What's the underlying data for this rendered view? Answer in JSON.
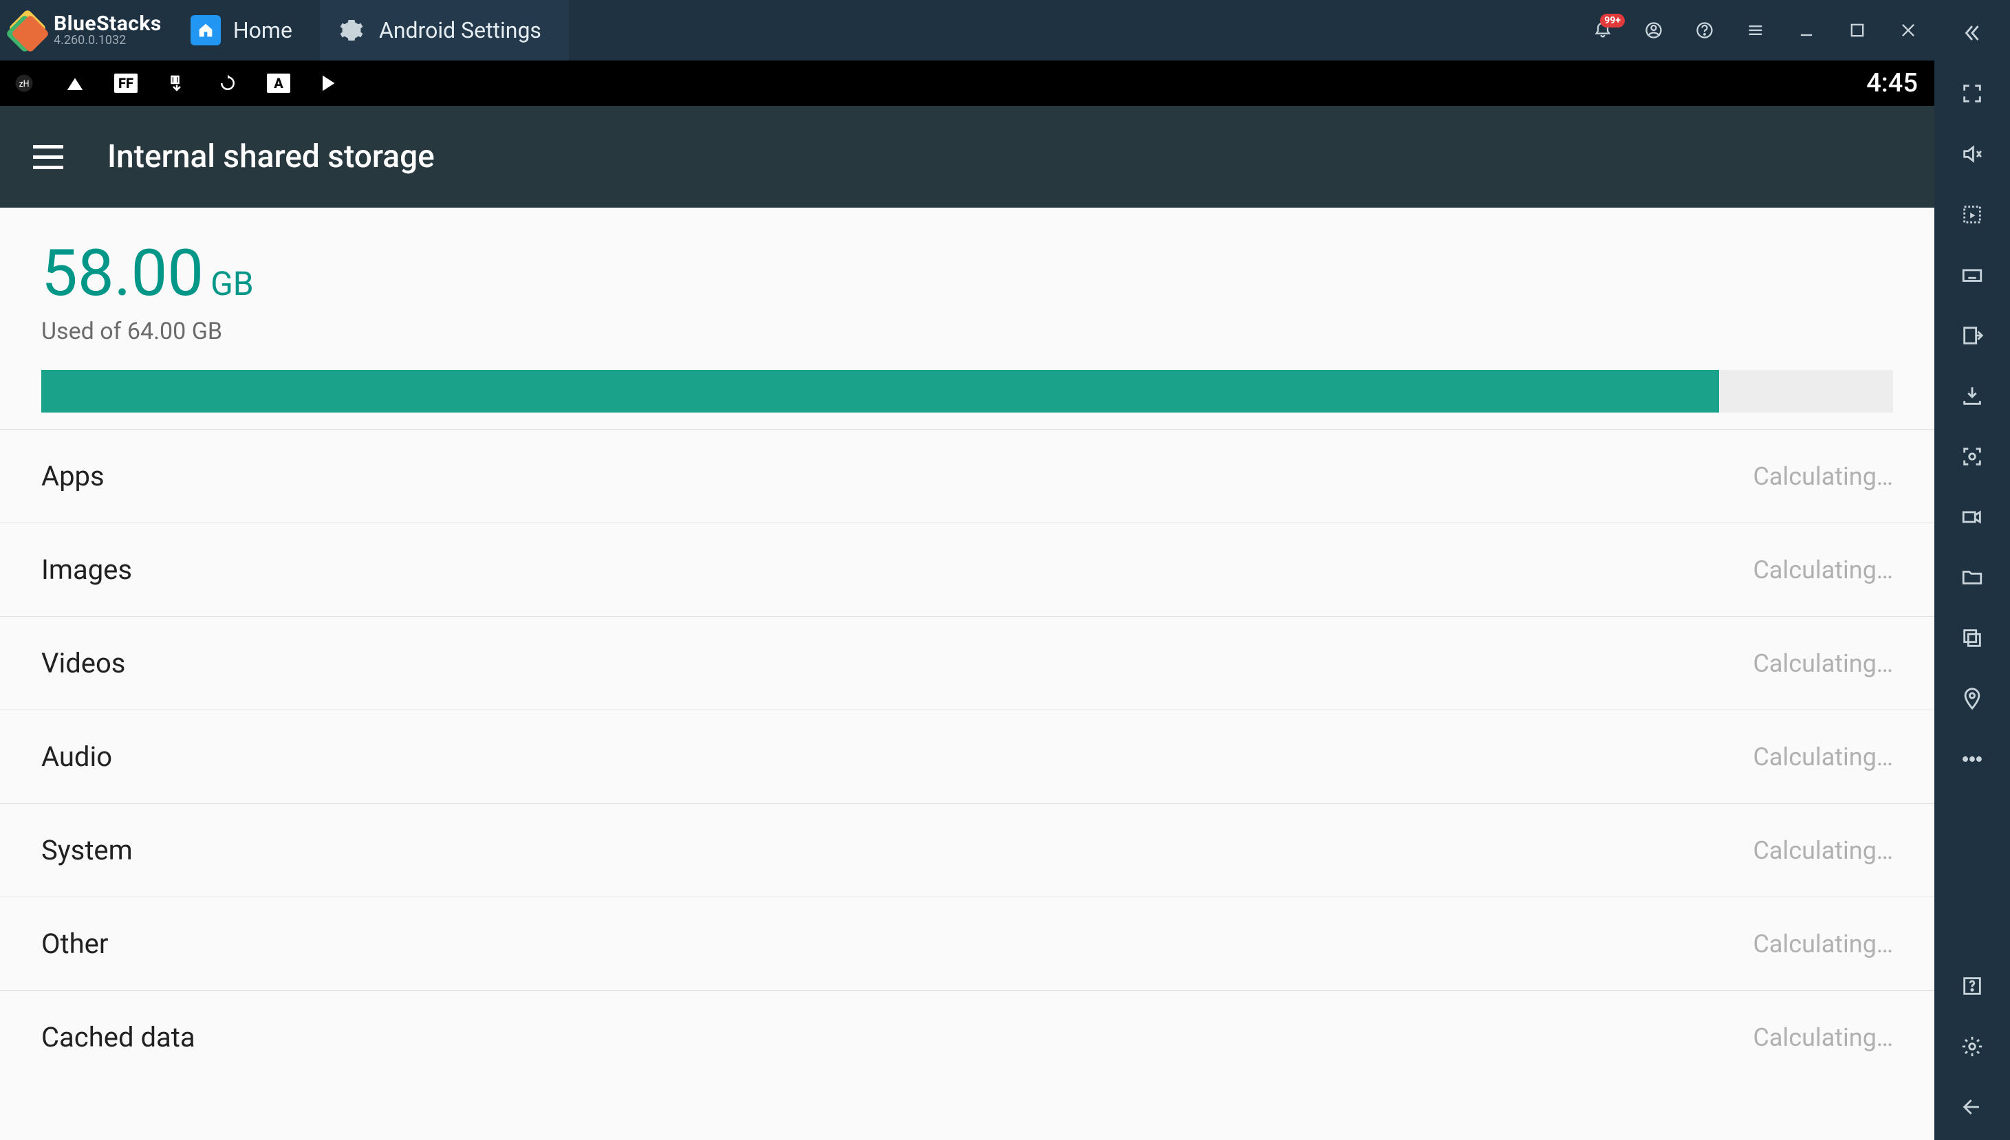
{
  "app": {
    "name": "BlueStacks",
    "version": "4.260.0.1032"
  },
  "tabs": [
    {
      "label": "Home",
      "active": false
    },
    {
      "label": "Android Settings",
      "active": true
    }
  ],
  "window_controls": {
    "notification_badge": "99+"
  },
  "status_bar": {
    "clock": "4:45"
  },
  "appbar": {
    "title": "Internal shared storage"
  },
  "storage": {
    "used_value": "58.00",
    "used_unit": "GB",
    "total_line": "Used of 64.00 GB",
    "fill_percent": 90.6
  },
  "categories": [
    {
      "label": "Apps",
      "value": "Calculating…"
    },
    {
      "label": "Images",
      "value": "Calculating…"
    },
    {
      "label": "Videos",
      "value": "Calculating…"
    },
    {
      "label": "Audio",
      "value": "Calculating…"
    },
    {
      "label": "System",
      "value": "Calculating…"
    },
    {
      "label": "Other",
      "value": "Calculating…"
    },
    {
      "label": "Cached data",
      "value": "Calculating…"
    }
  ]
}
